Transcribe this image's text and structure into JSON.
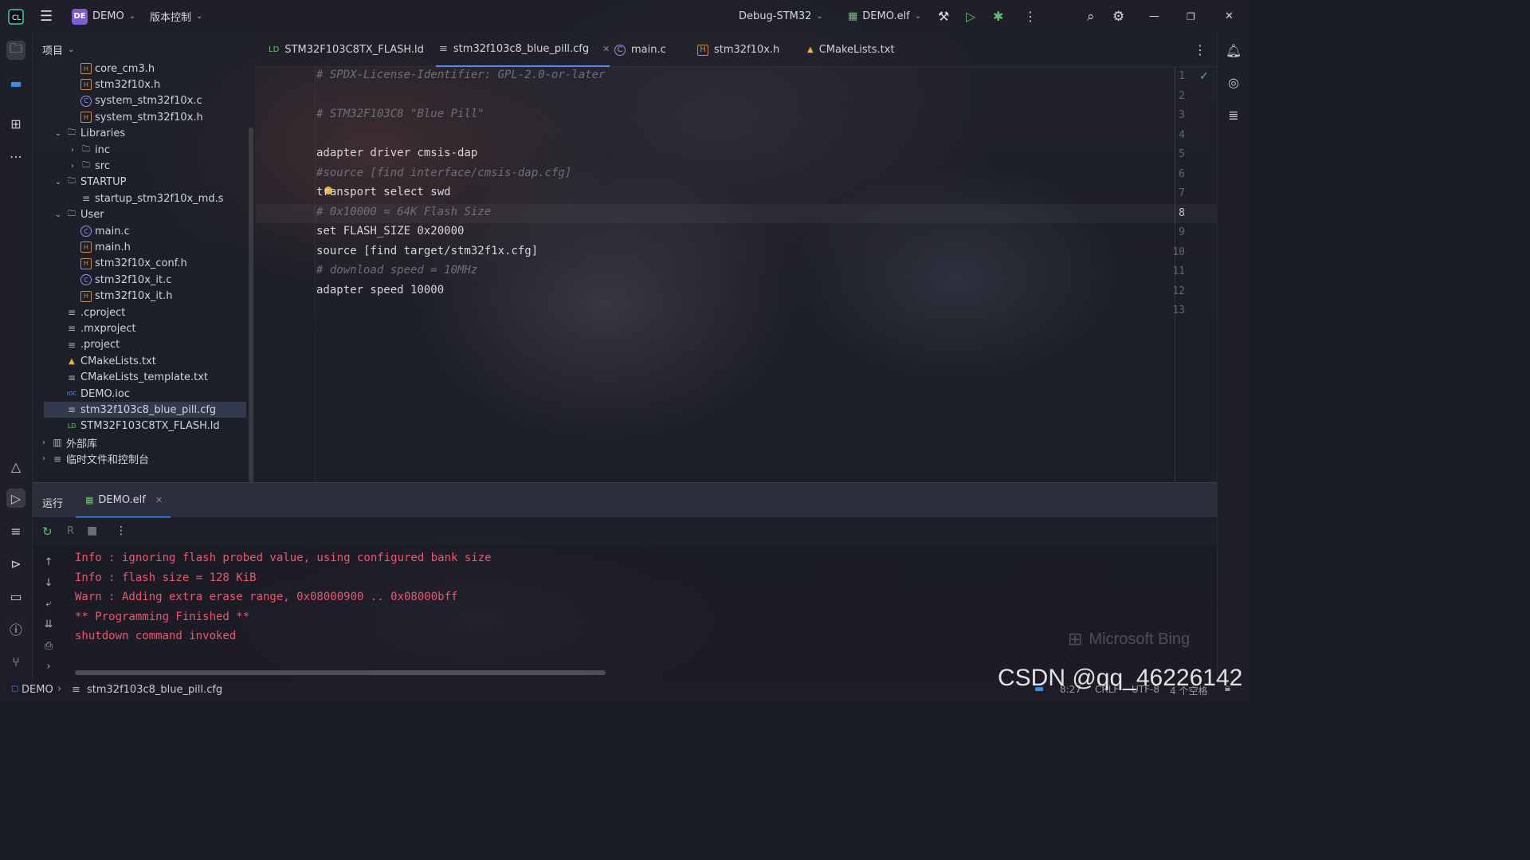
{
  "topbar": {
    "project_badge": "DE",
    "project_name": "DEMO",
    "vcs_menu": "版本控制",
    "run_config": "Debug-STM32",
    "target": "DEMO.elf"
  },
  "project_panel": {
    "title": "项目",
    "tree": [
      {
        "label": "core_cm3.h",
        "type": "h",
        "indent": 3
      },
      {
        "label": "stm32f10x.h",
        "type": "h",
        "indent": 3
      },
      {
        "label": "system_stm32f10x.c",
        "type": "c",
        "indent": 3
      },
      {
        "label": "system_stm32f10x.h",
        "type": "h",
        "indent": 3
      },
      {
        "label": "Libraries",
        "type": "folder",
        "indent": 2,
        "expanded": true
      },
      {
        "label": "inc",
        "type": "folder",
        "indent": 3,
        "expanded": false
      },
      {
        "label": "src",
        "type": "folder",
        "indent": 3,
        "expanded": false
      },
      {
        "label": "STARTUP",
        "type": "folder",
        "indent": 2,
        "expanded": true
      },
      {
        "label": "startup_stm32f10x_md.s",
        "type": "txt",
        "indent": 3
      },
      {
        "label": "User",
        "type": "folder",
        "indent": 2,
        "expanded": true
      },
      {
        "label": "main.c",
        "type": "c",
        "indent": 3
      },
      {
        "label": "main.h",
        "type": "h",
        "indent": 3
      },
      {
        "label": "stm32f10x_conf.h",
        "type": "h",
        "indent": 3
      },
      {
        "label": "stm32f10x_it.c",
        "type": "c",
        "indent": 3
      },
      {
        "label": "stm32f10x_it.h",
        "type": "h",
        "indent": 3
      },
      {
        "label": ".cproject",
        "type": "txt",
        "indent": 2
      },
      {
        "label": ".mxproject",
        "type": "txt",
        "indent": 2
      },
      {
        "label": ".project",
        "type": "txt",
        "indent": 2
      },
      {
        "label": "CMakeLists.txt",
        "type": "cmake",
        "indent": 2
      },
      {
        "label": "CMakeLists_template.txt",
        "type": "txt",
        "indent": 2
      },
      {
        "label": "DEMO.ioc",
        "type": "ioc",
        "indent": 2
      },
      {
        "label": "stm32f103c8_blue_pill.cfg",
        "type": "txt",
        "indent": 2,
        "selected": true
      },
      {
        "label": "STM32F103C8TX_FLASH.ld",
        "type": "ld",
        "indent": 2
      },
      {
        "label": "外部库",
        "type": "lib",
        "indent": 1,
        "expanded": false
      },
      {
        "label": "临时文件和控制台",
        "type": "scratch",
        "indent": 1,
        "expanded": false
      }
    ],
    "icon_badges": {
      "h": "H",
      "c": "C",
      "ld": "LD",
      "ioc": "IOC"
    }
  },
  "tabs": [
    {
      "label": "STM32F103C8TX_FLASH.ld",
      "icon": "ld-file-icon",
      "badge": "LD"
    },
    {
      "label": "stm32f103c8_blue_pill.cfg",
      "icon": "text-file-icon",
      "active": true
    },
    {
      "label": "main.c",
      "icon": "c-file-icon",
      "badge": "C"
    },
    {
      "label": "stm32f10x.h",
      "icon": "h-file-icon",
      "badge": "H"
    },
    {
      "label": "CMakeLists.txt",
      "icon": "cmake-icon"
    }
  ],
  "editor": {
    "current_line": 8,
    "lines": [
      {
        "n": "1",
        "text": "# SPDX-License-Identifier: GPL-2.0-or-later",
        "comment": true
      },
      {
        "n": "2",
        "text": "",
        "comment": false
      },
      {
        "n": "3",
        "text": "# STM32F103C8 \"Blue Pill\"",
        "comment": true
      },
      {
        "n": "4",
        "text": "",
        "comment": false
      },
      {
        "n": "5",
        "text": "adapter driver cmsis-dap",
        "comment": false
      },
      {
        "n": "6",
        "text": "#source [find interface/cmsis-dap.cfg]",
        "comment": true
      },
      {
        "n": "7",
        "text": "transport select swd",
        "comment": false
      },
      {
        "n": "8",
        "text": "# 0x10000 = 64K Flash Size",
        "comment": true
      },
      {
        "n": "9",
        "text": "set FLASH_SIZE 0x20000",
        "comment": false
      },
      {
        "n": "10",
        "text": "source [find target/stm32f1x.cfg]",
        "comment": false
      },
      {
        "n": "11",
        "text": "# download speed = 10MHz",
        "comment": true
      },
      {
        "n": "12",
        "text": "adapter speed 10000",
        "comment": false
      },
      {
        "n": "13",
        "text": "",
        "comment": false
      }
    ]
  },
  "run_panel": {
    "title": "运行",
    "tab_label": "DEMO.elf",
    "output": [
      "Info : ignoring flash probed value, using configured bank size",
      "Info : flash size = 128 KiB",
      "Warn : Adding extra erase range, 0x08000900 .. 0x08000bff",
      "** Programming Finished **",
      "shutdown command invoked"
    ],
    "output_color": "#f0566a"
  },
  "statusbar": {
    "project": "DEMO",
    "file": "stm32f103c8_blue_pill.cfg",
    "position": "8:27",
    "line_ending": "CRLF",
    "encoding": "UTF-8",
    "indent": "4 个空格"
  },
  "overlay": {
    "bing": "Microsoft Bing",
    "watermark": "CSDN @qq_46226142"
  },
  "colors": {
    "accent": "#4f8cf6",
    "project_badge": "#7e5bd6",
    "console_text": "#f0566a"
  }
}
